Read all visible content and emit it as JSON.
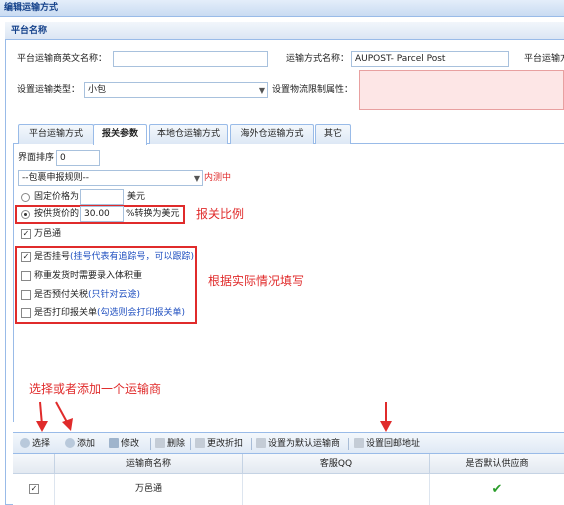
{
  "window_title": "编辑运输方式",
  "panel_title": "平台名称",
  "form": {
    "en_name_label": "平台运输商英文名称：",
    "en_name_value": "",
    "method_name_label": "运输方式名称：",
    "method_name_value": "AUPOST- Parcel Post",
    "platform_method_label": "平台运输方",
    "type_label": "设置运输类型：",
    "type_value": "小包",
    "restrict_label": "设置物流限制属性："
  },
  "tabs": [
    "平台运输方式",
    "报关参数",
    "本地仓运输方式",
    "海外仓运输方式",
    "其它"
  ],
  "active_tab": "报关参数",
  "customs": {
    "sort_label": "界面排序",
    "sort_value": "0",
    "rule_select": "--包裹申报规则--",
    "rule_note": "内测中",
    "fixed_price_label": "固定价格为",
    "fixed_unit": "美元",
    "by_price_label": "按供货价的",
    "by_price_value": "30.00",
    "by_price_suffix": "%转换为美元",
    "wanyitong_label": "万邑通",
    "opt1_label": "是否挂号",
    "opt1_hint": "(挂号代表有追踪号，可以跟踪)",
    "opt2_label": "称重发货时需要录入体积重",
    "opt3_label": "是否预付关税",
    "opt3_hint": "(只针对云途)",
    "opt4_label": "是否打印报关单",
    "opt4_hint": "(勾选则会打印报关单)"
  },
  "annotations": {
    "ratio": "报关比例",
    "fill": "根据实际情况填写",
    "choose": "选择或者添加一个运输商"
  },
  "toolbar": {
    "select": "选择",
    "add": "添加",
    "edit": "修改",
    "delete": "删除",
    "discount": "更改折扣",
    "set_default": "设置为默认运输商",
    "set_return": "设置回邮地址"
  },
  "grid": {
    "headers": [
      "运输商名称",
      "客服QQ",
      "是否默认供应商"
    ],
    "rows": [
      {
        "checked": true,
        "name": "万邑通",
        "qq": "",
        "is_default": true
      }
    ]
  },
  "colors": {
    "accent_red": "#e02b2b",
    "header_blue": "#15428b",
    "check_green": "#2a9d2a"
  }
}
